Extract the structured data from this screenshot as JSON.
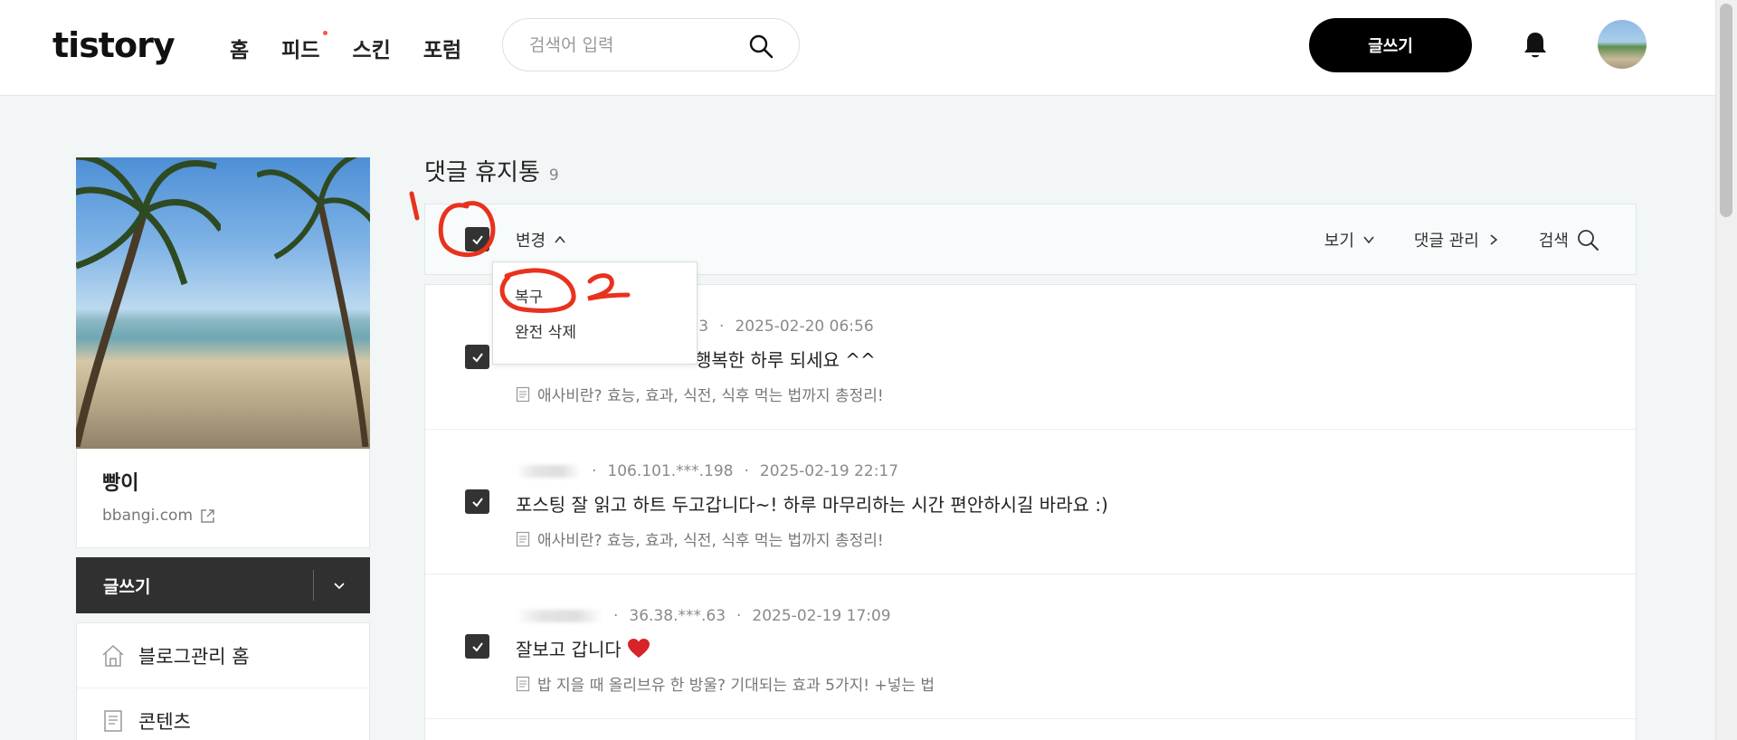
{
  "header": {
    "logo": "tistory",
    "nav": [
      {
        "label": "홈",
        "dot": false
      },
      {
        "label": "피드",
        "dot": true
      },
      {
        "label": "스킨",
        "dot": false
      },
      {
        "label": "포럼",
        "dot": false
      }
    ],
    "search_placeholder": "검색어 입력",
    "write_label": "글쓰기"
  },
  "sidebar": {
    "blog_name": "빵이",
    "blog_url": "bbangi.com",
    "write_label": "글쓰기",
    "menu": [
      {
        "label": "블로그관리 홈",
        "icon": "home-icon"
      },
      {
        "label": "콘텐츠",
        "icon": "document-icon"
      }
    ]
  },
  "main": {
    "title": "댓글 휴지통",
    "count": "9",
    "toolbar": {
      "change_label": "변경",
      "view_label": "보기",
      "manage_label": "댓글 관리",
      "search_label": "검색"
    },
    "dropdown": [
      "복구",
      "완전 삭제"
    ],
    "comments": [
      {
        "ip": ".63",
        "date": "2025-02-20 06:56",
        "text": "행복한 하루 되세요 ^^",
        "post": "애사비란? 효능, 효과, 식전, 식후 먹는 법까지 총정리!",
        "checked": true
      },
      {
        "ip": "106.101.***.198",
        "date": "2025-02-19 22:17",
        "text": "포스팅 잘 읽고 하트 두고갑니다~! 하루 마무리하는 시간 편안하시길 바라요 :)",
        "post": "애사비란? 효능, 효과, 식전, 식후 먹는 법까지 총정리!",
        "checked": true
      },
      {
        "ip": "36.38.***.63",
        "date": "2025-02-19 17:09",
        "text": "잘보고 갑니다",
        "post": "밥 지을 때 올리브유 한 방울? 기대되는 효과 5가지! +넣는 법",
        "checked": true
      }
    ]
  },
  "annotations": [
    "1",
    "2"
  ],
  "colors": {
    "accent": "#000000",
    "annotation_red": "#e8321e",
    "nav_dot": "#ff5544",
    "page_bg": "#f2f6f6"
  }
}
